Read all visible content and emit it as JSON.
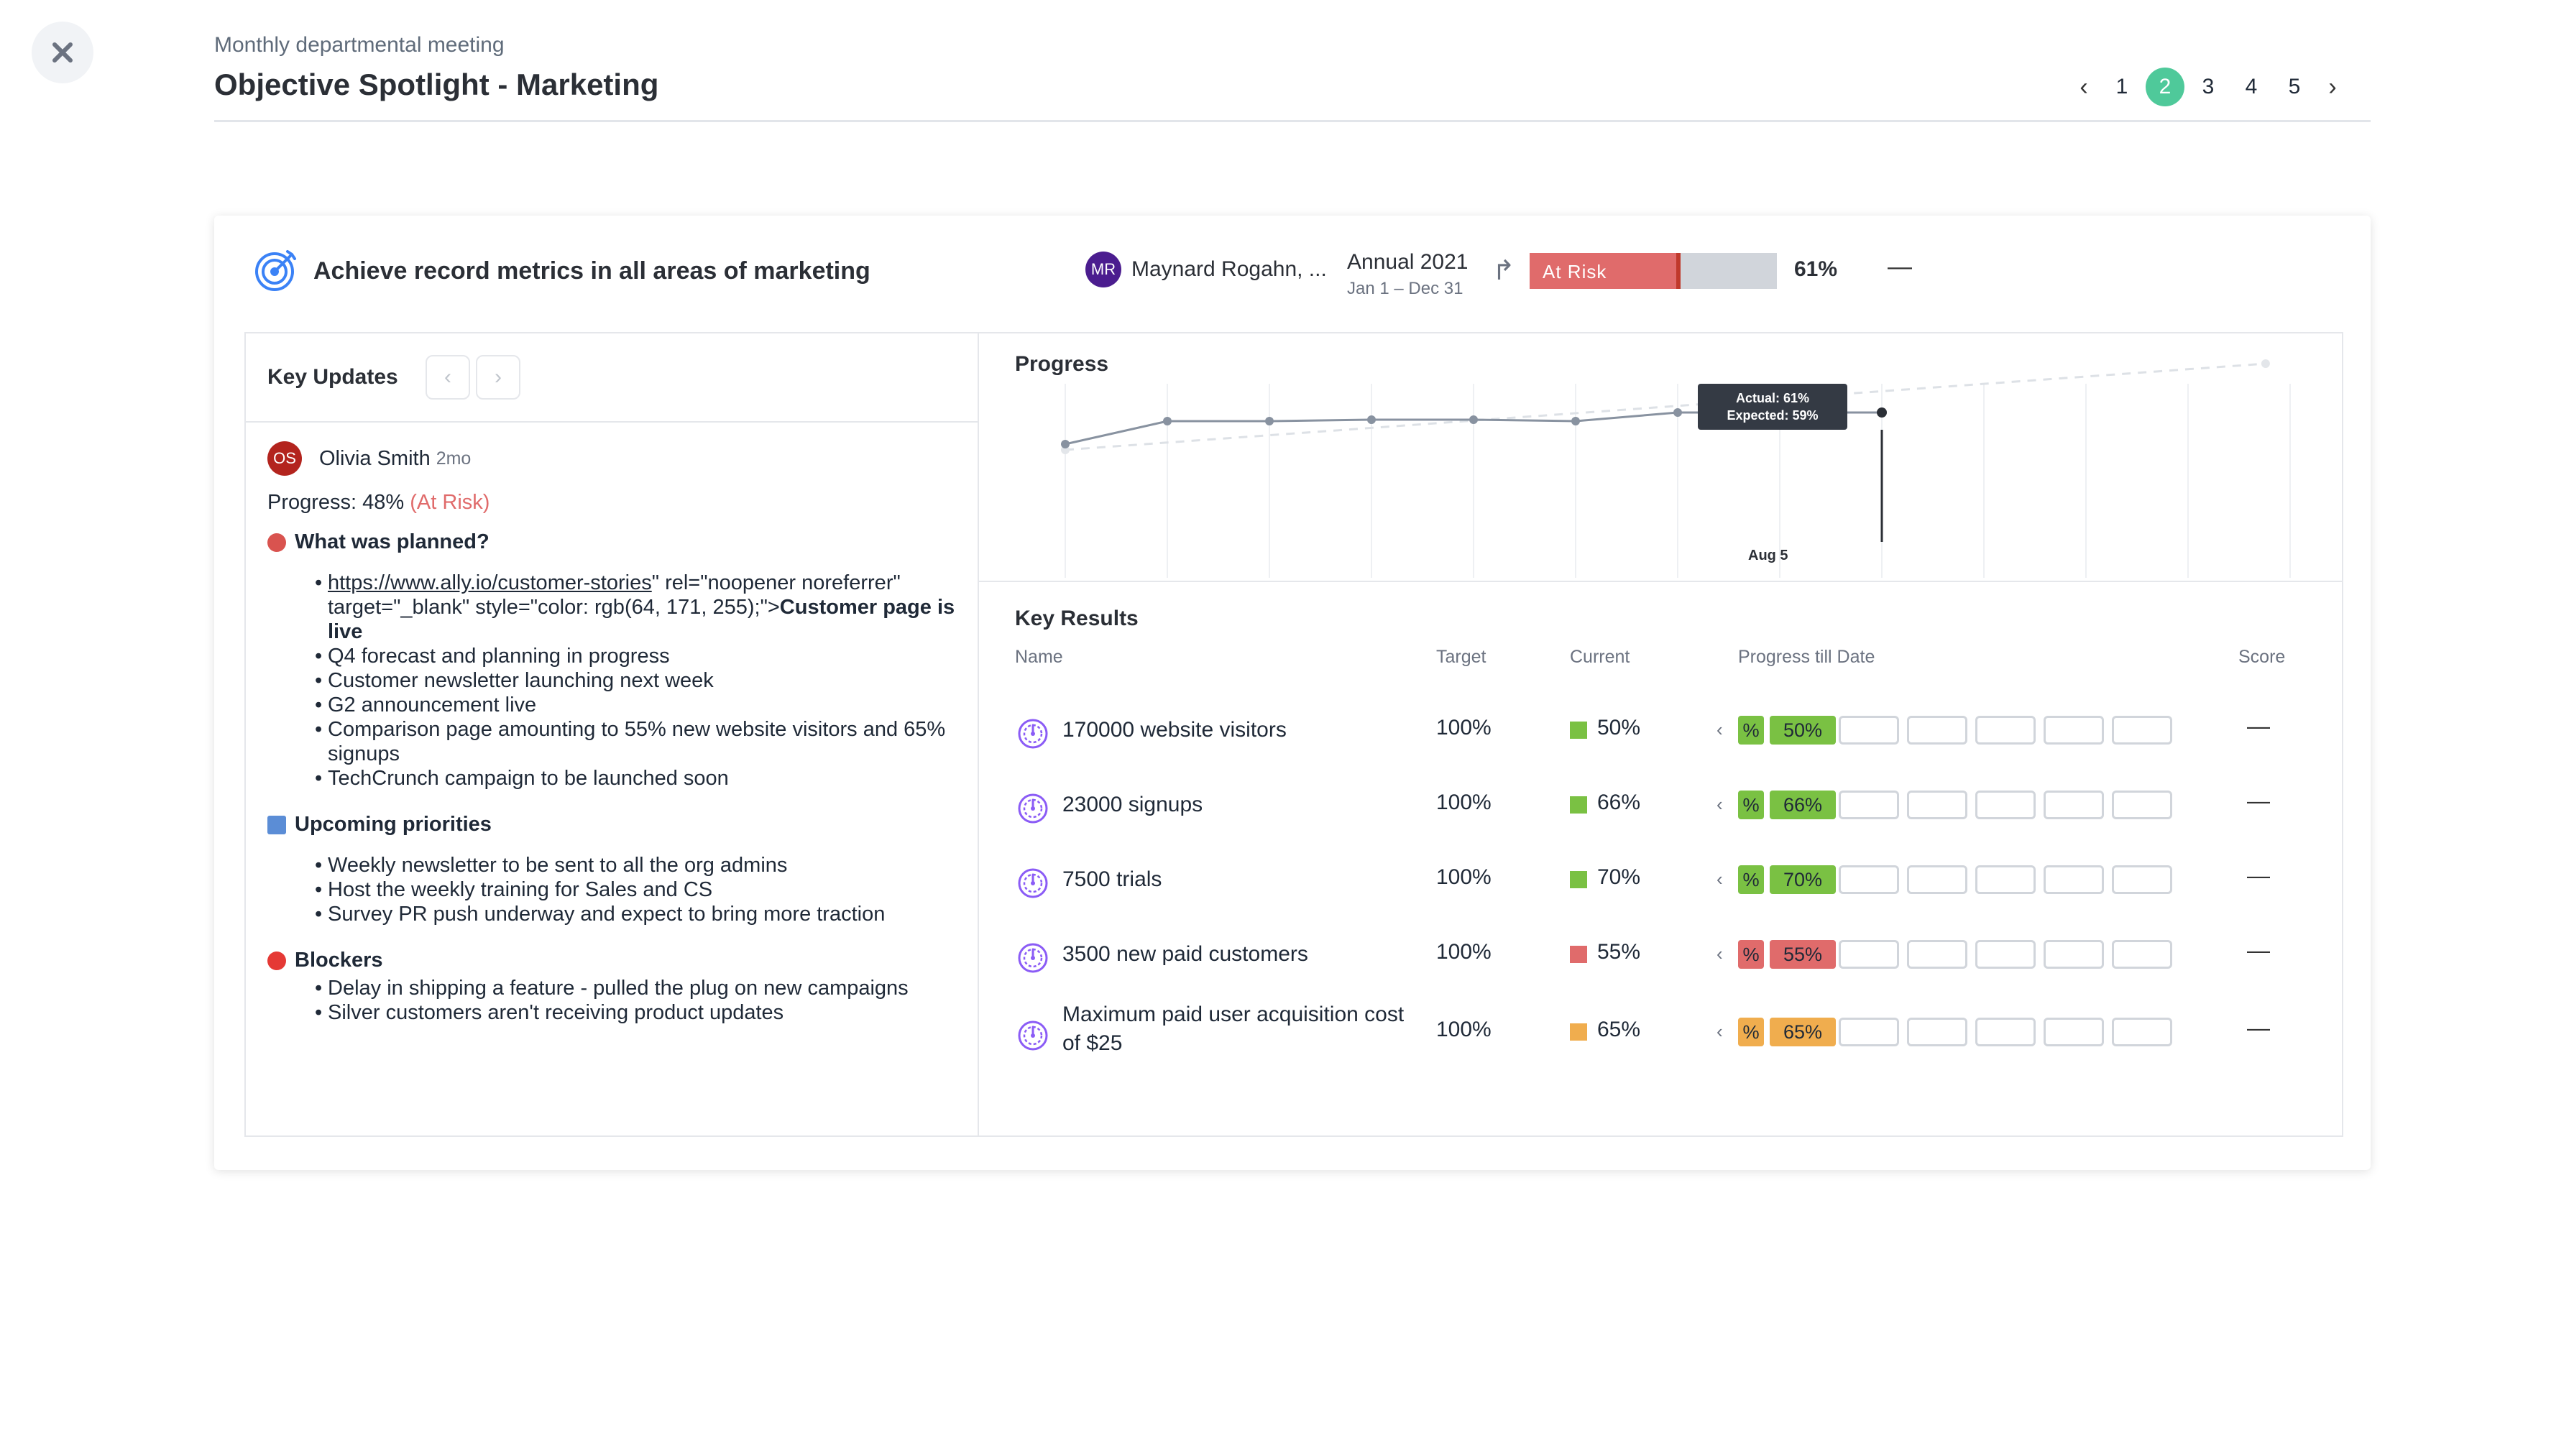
{
  "header": {
    "subtitle": "Monthly departmental meeting",
    "title": "Objective Spotlight - Marketing"
  },
  "pager": {
    "prev": "‹",
    "next": "›",
    "pages": [
      "1",
      "2",
      "3",
      "4",
      "5"
    ],
    "active_page": "2"
  },
  "objective": {
    "title": "Achieve record metrics in all areas of marketing",
    "owner_initials": "MR",
    "owner_name": "Maynard Rogahn, ...",
    "period": "Annual 2021",
    "period_range": "Jan 1 – Dec 31",
    "status": "At Risk",
    "progress": 0.61,
    "progress_label": "61%",
    "score": "—"
  },
  "key_updates": {
    "title": "Key Updates",
    "author_initials": "OS",
    "author": "Olivia Smith",
    "time": "2mo",
    "progress_text": "Progress: 48%",
    "progress_status": "(At Risk)",
    "planned_title": "What was planned?",
    "planned_link": "https://www.ally.io/customer-stories",
    "planned_link_rest": "\" rel=\"noopener noreferrer\" target=\"_blank\" style=\"color: rgb(64, 171, 255);\">",
    "planned_link_bold": "Customer page is live",
    "planned": [
      "Q4 forecast and planning in progress",
      "Customer newsletter launching next week",
      "G2 announcement live",
      "Comparison page amounting to 55% new website visitors and 65% signups",
      "TechCrunch campaign to be launched soon"
    ],
    "priorities_title": "Upcoming priorities",
    "priorities": [
      "Weekly newsletter to be sent to all the org admins",
      "Host the weekly training for Sales and CS",
      "Survey PR push underway and expect to bring more traction"
    ],
    "blockers_title": "Blockers",
    "blockers": [
      "Delay in shipping a feature - pulled the plug on new campaigns",
      "Silver customers aren't receiving product updates"
    ]
  },
  "progress_chart": {
    "title": "Progress",
    "tooltip_actual": "Actual: 61%",
    "tooltip_expected": "Expected: 59%",
    "tooltip_date": "Aug 5",
    "actual": [
      44,
      52,
      52,
      52.5,
      52.5,
      52,
      55,
      55,
      55
    ],
    "expected": [
      42,
      72
    ]
  },
  "key_results": {
    "title": "Key Results",
    "columns": {
      "name": "Name",
      "target": "Target",
      "current": "Current",
      "progress": "Progress till Date",
      "score": "Score"
    },
    "rows": [
      {
        "name_1": "170000 website visitors",
        "name_2": "",
        "target": "100%",
        "current": "50%",
        "color": "#7ac143",
        "pct_sym": "%",
        "value": "50%",
        "score": "—"
      },
      {
        "name_1": "23000 signups",
        "name_2": "",
        "target": "100%",
        "current": "66%",
        "color": "#7ac143",
        "pct_sym": "%",
        "value": "66%",
        "score": "—"
      },
      {
        "name_1": "7500 trials",
        "name_2": "",
        "target": "100%",
        "current": "70%",
        "color": "#7ac143",
        "pct_sym": "%",
        "value": "70%",
        "score": "—"
      },
      {
        "name_1": "3500 new paid customers",
        "name_2": "",
        "target": "100%",
        "current": "55%",
        "color": "#e06b6b",
        "pct_sym": "%",
        "value": "55%",
        "score": "—"
      },
      {
        "name_1": "Maximum paid user acquisition cost",
        "name_2": "of $25",
        "target": "100%",
        "current": "65%",
        "color": "#f0ad4e",
        "pct_sym": "%",
        "value": "65%",
        "score": "—"
      }
    ]
  },
  "colors": {
    "accent": "#4fc99a",
    "at_risk": "#e06b6b",
    "on_track": "#7ac143",
    "behind": "#f0ad4e",
    "kr_icon": "#8b5cf6",
    "objective_icon": "#3b82f6"
  },
  "icons": {
    "close": "close-icon",
    "objective": "target-icon",
    "trend": "trend-arrow-icon",
    "key_result": "gauge-icon"
  }
}
